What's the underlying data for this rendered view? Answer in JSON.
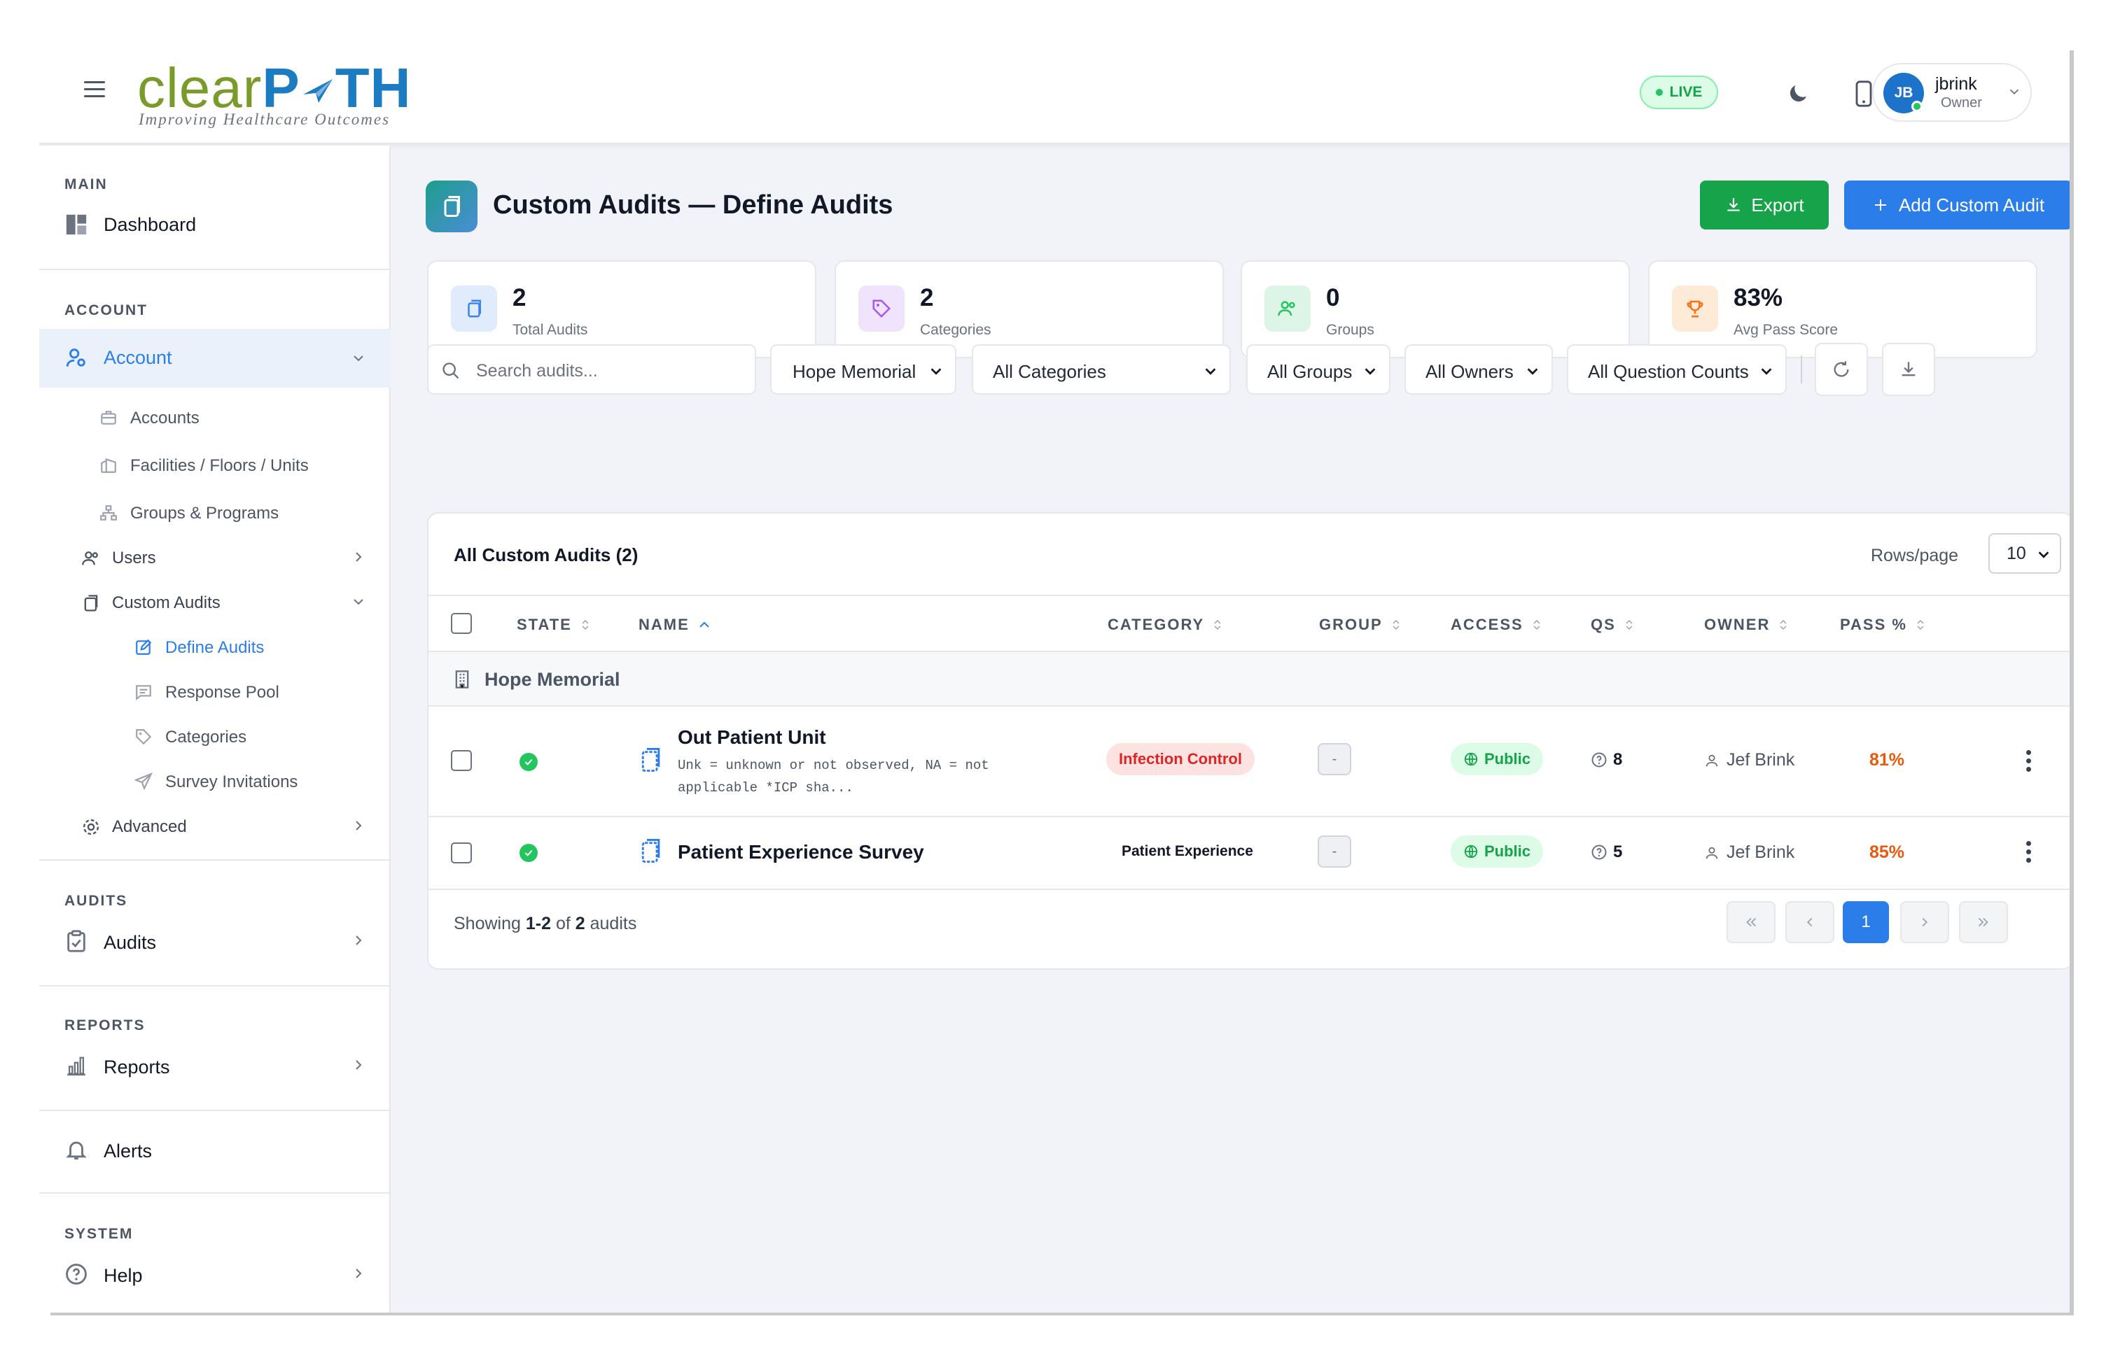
{
  "header": {
    "logo_clear": "clear",
    "logo_path": "P",
    "logo_path2": "TH",
    "tagline": "Improving Healthcare Outcomes",
    "live_label": "LIVE",
    "user": {
      "initials": "JB",
      "name": "jbrink",
      "role": "Owner"
    }
  },
  "sidebar": {
    "main_label": "MAIN",
    "dashboard": "Dashboard",
    "account_label": "ACCOUNT",
    "account": "Account",
    "accounts": "Accounts",
    "facilities": "Facilities / Floors / Units",
    "groups_programs": "Groups & Programs",
    "users": "Users",
    "custom_audits": "Custom Audits",
    "define_audits": "Define Audits",
    "response_pool": "Response Pool",
    "categories": "Categories",
    "survey_invitations": "Survey Invitations",
    "advanced": "Advanced",
    "audits_label": "AUDITS",
    "audits": "Audits",
    "reports_label": "REPORTS",
    "reports": "Reports",
    "alerts": "Alerts",
    "system_label": "SYSTEM",
    "help": "Help"
  },
  "page": {
    "title": "Custom Audits — Define Audits",
    "export_label": "Export",
    "add_label": "Add Custom Audit"
  },
  "stats": [
    {
      "value": "2",
      "label": "Total Audits"
    },
    {
      "value": "2",
      "label": "Categories"
    },
    {
      "value": "0",
      "label": "Groups"
    },
    {
      "value": "83%",
      "label": "Avg Pass Score"
    }
  ],
  "filters": {
    "search_placeholder": "Search audits...",
    "facility": "Hope Memorial",
    "category": "All Categories",
    "group": "All Groups",
    "owner": "All Owners",
    "question_count": "All Question Counts"
  },
  "table": {
    "title": "All Custom Audits (2)",
    "rows_per_page_label": "Rows/page",
    "rows_per_page": "10",
    "columns": {
      "state": "STATE",
      "name": "NAME",
      "category": "CATEGORY",
      "group": "GROUP",
      "access": "ACCESS",
      "qs": "QS",
      "owner": "OWNER",
      "pass": "PASS %"
    },
    "group_name": "Hope Memorial",
    "rows": [
      {
        "name": "Out Patient Unit",
        "description": "Unk = unknown or not observed, NA = not applicable *ICP sha...",
        "category": "Infection Control",
        "group": "-",
        "access": "Public",
        "qs": "8",
        "owner": "Jef Brink",
        "pass": "81%"
      },
      {
        "name": "Patient Experience Survey",
        "description": "",
        "category": "Patient Experience",
        "group": "-",
        "access": "Public",
        "qs": "5",
        "owner": "Jef Brink",
        "pass": "85%"
      }
    ],
    "showing_prefix": "Showing",
    "showing_range": "1-2",
    "showing_of": "of",
    "showing_total": "2",
    "showing_suffix": "audits",
    "current_page": "1"
  },
  "colors": {
    "accent": "#2b7de9",
    "success": "#16a34a",
    "danger": "#dc2626",
    "warning": "#ea580c"
  }
}
